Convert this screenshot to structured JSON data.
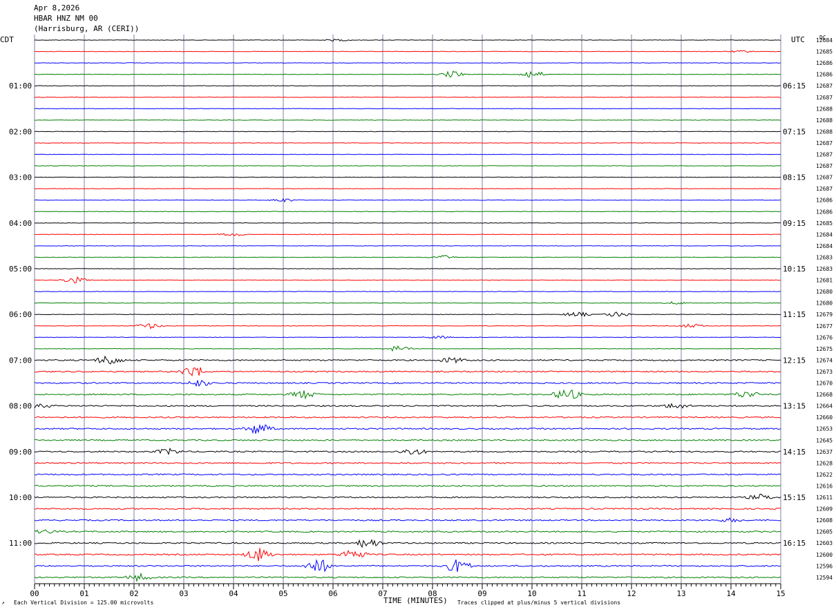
{
  "header": {
    "date": "Apr 8,2026",
    "station": "HBAR HNZ NM 00",
    "location": "(Harrisburg, AR (CERI))"
  },
  "axes": {
    "left_tz": "CDT",
    "right_tz": "UTC",
    "dc_label": "DC",
    "x_title": "TIME (MINUTES)",
    "x_ticks": [
      "00",
      "01",
      "02",
      "03",
      "04",
      "05",
      "06",
      "07",
      "08",
      "09",
      "10",
      "11",
      "12",
      "13",
      "14",
      "15"
    ]
  },
  "footer": {
    "scale_note": "Each Vertical Division =  125.00 microvolts",
    "clip_note": "Traces clipped at plus/minus 5 vertical divisions"
  },
  "colors": {
    "cycle": [
      "#000000",
      "#ff0000",
      "#0000ff",
      "#007f00"
    ],
    "grid": "#7f7f9f"
  },
  "chart_data": {
    "type": "helicorder",
    "minutes_per_line": 15,
    "xlim": [
      0,
      15
    ],
    "left_hour_labels": [
      "01:00",
      "02:00",
      "03:00",
      "04:00",
      "05:00",
      "06:00",
      "07:00",
      "08:00",
      "09:00",
      "10:00",
      "11:00"
    ],
    "right_hour_labels": [
      "06:15",
      "07:15",
      "08:15",
      "09:15",
      "10:15",
      "11:15",
      "12:15",
      "13:15",
      "14:15",
      "15:15",
      "16:15"
    ],
    "dc_offsets": [
      12684,
      12685,
      12686,
      12686,
      12687,
      12687,
      12688,
      12688,
      12688,
      12687,
      12687,
      12687,
      12687,
      12687,
      12686,
      12686,
      12685,
      12684,
      12684,
      12683,
      12683,
      12681,
      12680,
      12680,
      12679,
      12677,
      12676,
      12675,
      12674,
      12673,
      12670,
      12668,
      12664,
      12660,
      12653,
      12645,
      12637,
      12628,
      12622,
      12616,
      12611,
      12609,
      12608,
      12605,
      12603,
      12600,
      12596,
      12594
    ],
    "events": [
      {
        "line": 0,
        "minute": 6.1,
        "amp": 0.3
      },
      {
        "line": 1,
        "minute": 14.2,
        "amp": 0.3
      },
      {
        "line": 3,
        "minute": 10.0,
        "amp": 1.2
      },
      {
        "line": 3,
        "minute": 8.4,
        "amp": 1.0
      },
      {
        "line": 14,
        "minute": 5.0,
        "amp": 0.6
      },
      {
        "line": 17,
        "minute": 4.0,
        "amp": 0.5
      },
      {
        "line": 19,
        "minute": 8.2,
        "amp": 0.6
      },
      {
        "line": 21,
        "minute": 0.8,
        "amp": 1.0
      },
      {
        "line": 23,
        "minute": 12.9,
        "amp": 0.4
      },
      {
        "line": 24,
        "minute": 10.9,
        "amp": 0.8
      },
      {
        "line": 24,
        "minute": 11.7,
        "amp": 0.8
      },
      {
        "line": 25,
        "minute": 2.3,
        "amp": 0.8
      },
      {
        "line": 25,
        "minute": 13.2,
        "amp": 0.6
      },
      {
        "line": 26,
        "minute": 8.1,
        "amp": 0.4
      },
      {
        "line": 27,
        "minute": 7.3,
        "amp": 0.8
      },
      {
        "line": 28,
        "minute": 1.5,
        "amp": 1.5
      },
      {
        "line": 28,
        "minute": 8.4,
        "amp": 0.8
      },
      {
        "line": 29,
        "minute": 3.2,
        "amp": 1.8
      },
      {
        "line": 30,
        "minute": 3.3,
        "amp": 1.0
      },
      {
        "line": 31,
        "minute": 5.4,
        "amp": 1.2
      },
      {
        "line": 31,
        "minute": 10.7,
        "amp": 1.8
      },
      {
        "line": 31,
        "minute": 14.3,
        "amp": 1.0
      },
      {
        "line": 32,
        "minute": 0.1,
        "amp": 0.6
      },
      {
        "line": 32,
        "minute": 12.9,
        "amp": 0.8
      },
      {
        "line": 34,
        "minute": 4.5,
        "amp": 1.8
      },
      {
        "line": 36,
        "minute": 2.7,
        "amp": 0.8
      },
      {
        "line": 36,
        "minute": 7.6,
        "amp": 1.0
      },
      {
        "line": 40,
        "minute": 14.6,
        "amp": 0.8
      },
      {
        "line": 42,
        "minute": 14.0,
        "amp": 0.5
      },
      {
        "line": 43,
        "minute": 0.2,
        "amp": 0.5
      },
      {
        "line": 44,
        "minute": 6.7,
        "amp": 1.5
      },
      {
        "line": 45,
        "minute": 4.5,
        "amp": 2.0
      },
      {
        "line": 45,
        "minute": 6.4,
        "amp": 1.6
      },
      {
        "line": 46,
        "minute": 5.7,
        "amp": 2.2
      },
      {
        "line": 46,
        "minute": 8.5,
        "amp": 2.0
      },
      {
        "line": 47,
        "minute": 2.1,
        "amp": 1.0
      }
    ]
  }
}
